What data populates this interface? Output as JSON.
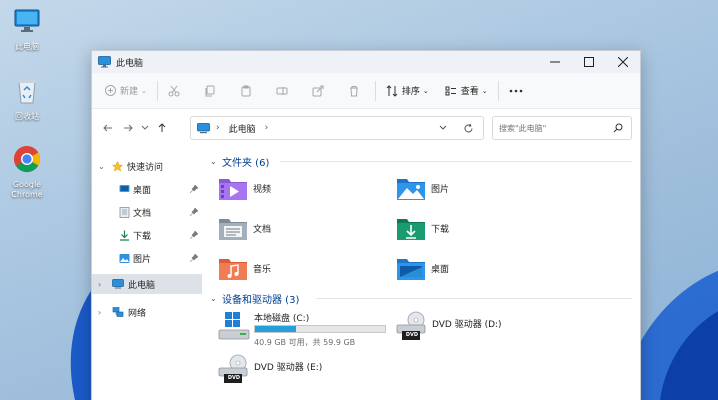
{
  "desktop": {
    "icons": [
      {
        "label": "此电脑"
      },
      {
        "label": "回收站"
      },
      {
        "label": "Google Chrome"
      }
    ]
  },
  "window": {
    "title": "此电脑",
    "accent_color": "#0067c0",
    "controls": {
      "minimize": "minimize-icon",
      "maximize": "maximize-icon",
      "close": "close-icon"
    }
  },
  "commandbar": {
    "new_label": "新建",
    "sort_label": "排序",
    "view_label": "查看",
    "icons": [
      "plus-icon",
      "cut-icon",
      "copy-icon",
      "paste-icon",
      "rename-icon",
      "share-icon",
      "delete-icon",
      "sort-icon",
      "view-icon",
      "more-icon"
    ]
  },
  "addressbar": {
    "breadcrumb": [
      "此电脑"
    ],
    "search_placeholder": "搜索\"此电脑\""
  },
  "sidebar": {
    "quick_access": {
      "label": "快速访问",
      "items": [
        {
          "label": "桌面",
          "pinned": true
        },
        {
          "label": "文档",
          "pinned": true
        },
        {
          "label": "下载",
          "pinned": true
        },
        {
          "label": "图片",
          "pinned": true
        }
      ]
    },
    "this_pc": {
      "label": "此电脑",
      "selected": true
    },
    "network": {
      "label": "网络"
    }
  },
  "content": {
    "folders_header": "文件夹 (6)",
    "folders": [
      {
        "label": "视频",
        "icon": "video-folder-icon"
      },
      {
        "label": "图片",
        "icon": "pictures-folder-icon"
      },
      {
        "label": "文档",
        "icon": "documents-folder-icon"
      },
      {
        "label": "下载",
        "icon": "downloads-folder-icon"
      },
      {
        "label": "音乐",
        "icon": "music-folder-icon"
      },
      {
        "label": "桌面",
        "icon": "desktop-folder-icon"
      }
    ],
    "drives_header": "设备和驱动器 (3)",
    "drives": [
      {
        "label": "本地磁盘 (C:)",
        "size_text": "40.9 GB 可用，共 59.9 GB",
        "used_fraction": 0.317
      },
      {
        "label": "DVD 驱动器 (D:)",
        "badge": "DVD"
      },
      {
        "label": "DVD 驱动器 (E:)",
        "badge": "DVD"
      }
    ]
  }
}
